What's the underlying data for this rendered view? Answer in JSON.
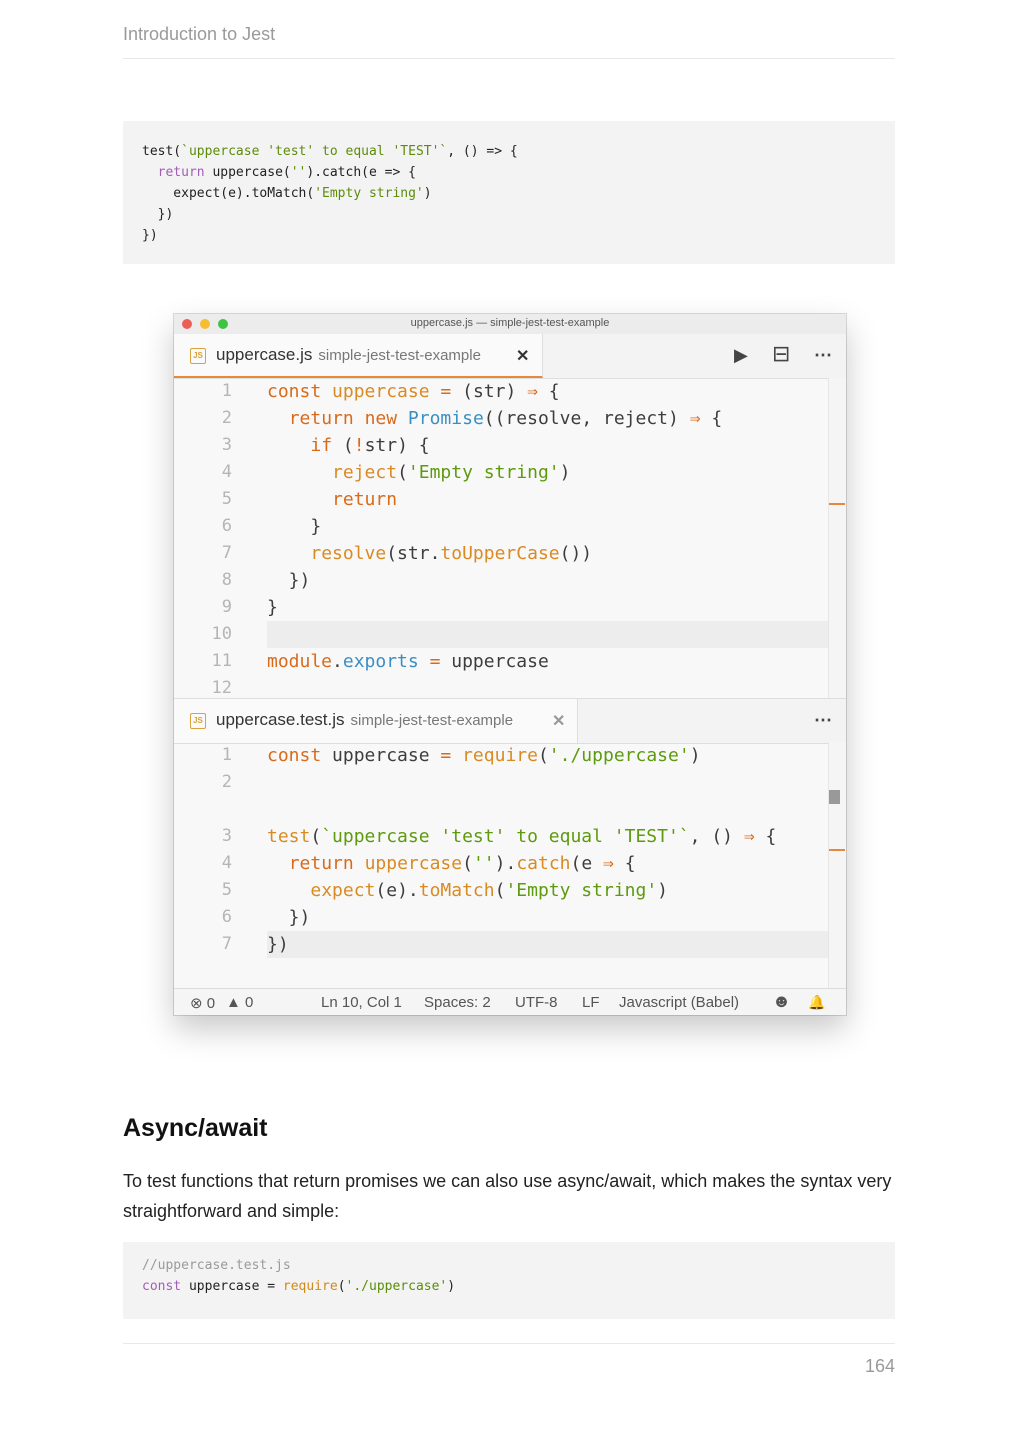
{
  "running_head": "Introduction to Jest",
  "code_block_1": {
    "lines": [
      [
        "test(",
        "`uppercase 'test' to equal 'TEST'`",
        ", () => {"
      ],
      [
        "  ",
        "return",
        " uppercase(",
        "''",
        ").catch(e => {"
      ],
      [
        "    expect(e).toMatch(",
        "'Empty string'",
        ")"
      ],
      [
        "  })"
      ],
      [
        "})"
      ]
    ]
  },
  "editor": {
    "window_title": "uppercase.js — simple-jest-test-example",
    "pane1": {
      "file_name": "uppercase.js",
      "project": "simple-jest-test-example",
      "close_glyph": "✕",
      "run_glyph": "▶",
      "split_glyph": "⊟",
      "more_glyph": "⋯"
    },
    "pane2": {
      "file_name": "uppercase.test.js",
      "project": "simple-jest-test-example",
      "close_glyph": "✕",
      "more_glyph": "⋯"
    },
    "file1_line_numbers": [
      "1",
      "2",
      "3",
      "4",
      "5",
      "6",
      "7",
      "8",
      "9",
      "10",
      "11",
      "12"
    ],
    "file2_line_numbers": [
      "1",
      "2",
      "3",
      "4",
      "5",
      "6",
      "7"
    ],
    "status": {
      "errors": "⊗ 0",
      "warnings": "▲ 0",
      "cursor": "Ln 10, Col 1",
      "spaces": "Spaces: 2",
      "encoding": "UTF-8",
      "eol": "LF",
      "language": "Javascript (Babel)",
      "smiley_icon": "☻",
      "bell_icon": "🔔"
    }
  },
  "section_heading": "Async/await",
  "paragraph": "To test functions that return promises we can also use async/await, which makes the syntax very straightforward and simple:",
  "code_block_2": {
    "comment": "//uppercase.test.js",
    "kw": "const",
    "mid": " uppercase = ",
    "fn": "require",
    "open": "(",
    "str": "'./uppercase'",
    "close": ")"
  },
  "page_number": "164",
  "colors": {
    "accent_orange": "#e8883a",
    "string_green": "#5d9a0e",
    "keyword_orange": "#d96a1a",
    "builtin_blue": "#3a8fc2"
  }
}
